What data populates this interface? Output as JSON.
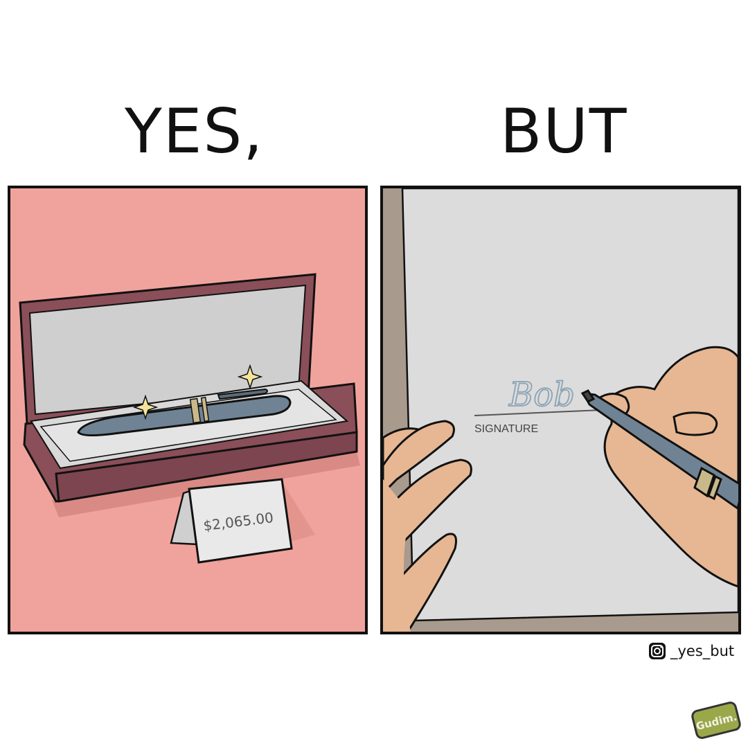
{
  "headline": {
    "left": "YES,",
    "right": "BUT"
  },
  "left_panel": {
    "price_tag": "$2,065.00",
    "colors": {
      "background": "#f0a39c",
      "case": "#8a4f58",
      "lining": "#d6d6d6",
      "pen": "#6f8394",
      "sparkle": "#f3e49a"
    }
  },
  "right_panel": {
    "signature_label": "SIGNATURE",
    "signature_handwriting": "Bob",
    "colors": {
      "desk": "#a89a8c",
      "paper": "#dcdcdc",
      "skin": "#e6b792",
      "ink": "#8aa3b4"
    }
  },
  "credit": {
    "icon": "instagram-icon",
    "handle": "_yes_but"
  },
  "badge": {
    "text": "Gudim."
  }
}
